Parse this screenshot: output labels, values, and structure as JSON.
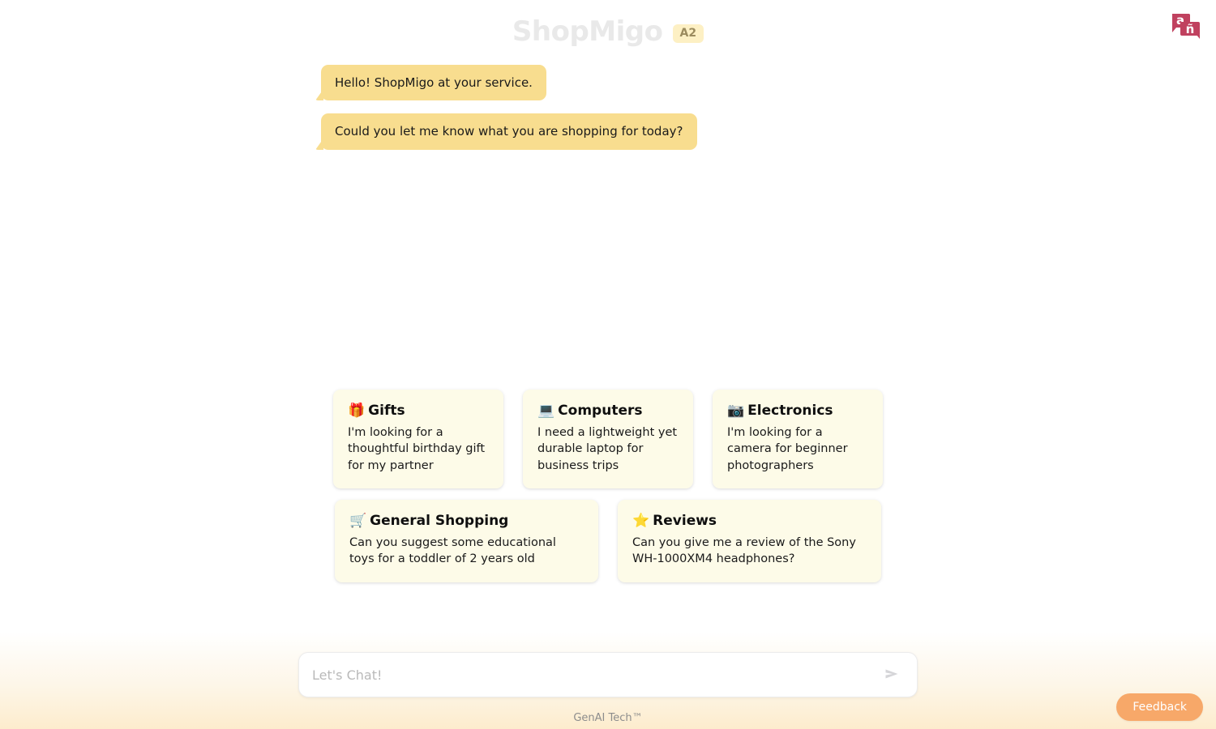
{
  "header": {
    "app_title": "ShopMigo",
    "language_badge": "A2",
    "translate_icon_name": "translate-bubbles-icon",
    "translate_icon_letters": {
      "primary": "a",
      "secondary": "ñ"
    },
    "brand_color": "#e9e9e9",
    "badge_bg": "#fdf0c4",
    "badge_text_color": "#9b8b5e",
    "translate_icon_color": "#c0415f"
  },
  "chat": {
    "messages": [
      {
        "role": "assistant",
        "text": "Hello! ShopMigo at your service."
      },
      {
        "role": "assistant",
        "text": "Could you let me know what you are shopping for today?"
      }
    ],
    "bubble_color": "#f8dd8f"
  },
  "suggestions": {
    "row1": [
      {
        "emoji": "🎁",
        "title": "Gifts",
        "prompt": "I'm looking for a thoughtful birthday gift for my partner"
      },
      {
        "emoji": "💻",
        "title": "Computers",
        "prompt": "I need a lightweight yet durable laptop for business trips"
      },
      {
        "emoji": "📷",
        "title": "Electronics",
        "prompt": "I'm looking for a camera for beginner photographers"
      }
    ],
    "row2": [
      {
        "emoji": "🛒",
        "title": "General Shopping",
        "prompt": "Can you suggest some educational toys for a toddler of 2 years old"
      },
      {
        "emoji": "⭐",
        "title": "Reviews",
        "prompt": "Can you give me a review of the Sony WH-1000XM4 headphones?"
      }
    ],
    "card_bg": "#fdfbe8"
  },
  "composer": {
    "value": "",
    "placeholder": "Let's Chat!",
    "send_icon_name": "send-arrow-icon",
    "send_icon_color": "#d5d5d8"
  },
  "footer": {
    "text": "GenAI Tech™"
  },
  "feedback": {
    "label": "Feedback",
    "color": "#f7a869"
  }
}
